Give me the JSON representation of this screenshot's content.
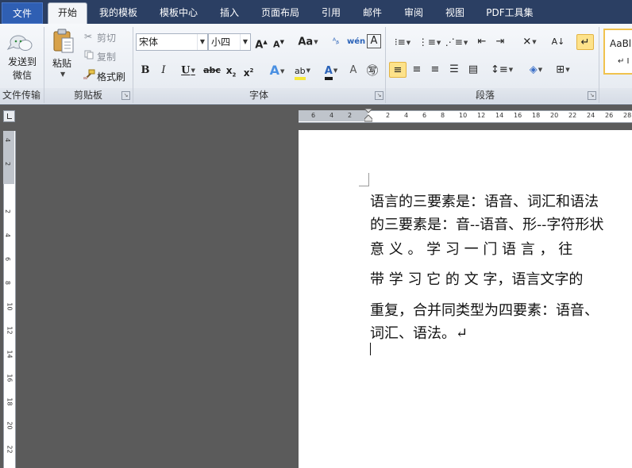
{
  "tabs": [
    "文件",
    "开始",
    "我的模板",
    "模板中心",
    "插入",
    "页面布局",
    "引用",
    "邮件",
    "审阅",
    "视图",
    "PDF工具集"
  ],
  "groups": {
    "file_transfer": {
      "button_label": "发送到\n微信",
      "label": "文件传输"
    },
    "clipboard": {
      "paste": "粘贴",
      "cut": "剪切",
      "copy": "复制",
      "format_painter": "格式刷",
      "label": "剪贴板"
    },
    "font": {
      "font_name": "宋体",
      "font_size": "小四",
      "label": "字体"
    },
    "paragraph": {
      "label": "段落"
    },
    "styles": {
      "preview": "AaBl"
    }
  },
  "ruler": {
    "h_numbers": [
      "6",
      "4",
      "2",
      "2",
      "4",
      "6",
      "8",
      "10",
      "12",
      "14",
      "16",
      "18",
      "20",
      "22",
      "24",
      "26",
      "28"
    ],
    "v_numbers": [
      "4",
      "2",
      "2",
      "4",
      "6",
      "8",
      "10",
      "12",
      "14",
      "16",
      "18",
      "20",
      "22"
    ]
  },
  "document": {
    "lines": [
      "语言的三要素是：语音、词汇和语法",
      "的三要素是：音--语音、形--字符形状",
      "意 义 。 学 习 一 门 语 言 ， 往",
      "带 学 习 它 的 文 字，语言文字的",
      "重复，合并同类型为四要素：语音、",
      "词汇、语法。↵"
    ]
  },
  "colors": {
    "tabbar": "#2b3f63",
    "file_tab": "#2f5fb3",
    "workspace": "#5b5b5b",
    "page": "#ffffff",
    "highlight": "#fde28a"
  }
}
